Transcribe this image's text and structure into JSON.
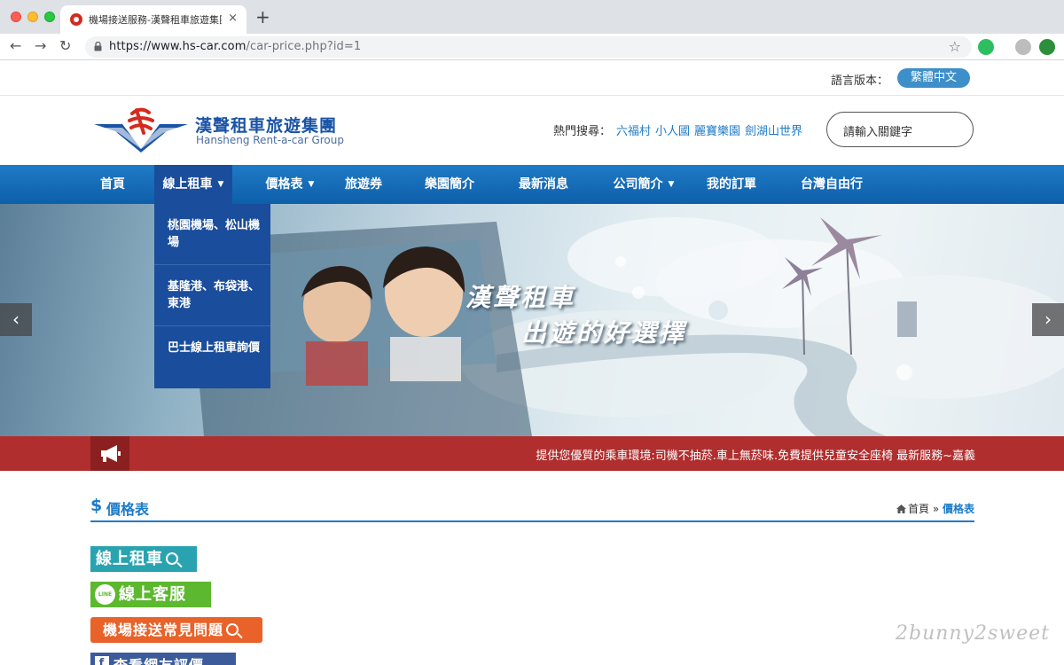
{
  "browser": {
    "tab_title": "機場接送服務-漢聲租車旅遊集團",
    "tab_close": "×",
    "new_tab": "+",
    "url_host": "https://www.hs-car.com",
    "url_path": "/car-price.php?id=1",
    "back": "←",
    "forward": "→",
    "reload": "↻",
    "bookmark": "☆"
  },
  "lang": {
    "label": "語言版本：",
    "current": "繁體中文"
  },
  "brand": {
    "name_zh": "漢聲租車旅遊集團",
    "name_en": "Hansheng Rent-a-car Group"
  },
  "hot_search": {
    "label": "熱門搜尋：",
    "links": [
      "六福村",
      "小人國",
      "麗寶樂園",
      "劍湖山世界"
    ],
    "placeholder": "請輸入關鍵字"
  },
  "nav": {
    "items": [
      {
        "label": "首頁",
        "caret": ""
      },
      {
        "label": "線上租車",
        "caret": "▼"
      },
      {
        "label": "價格表",
        "caret": "▼"
      },
      {
        "label": "旅遊券",
        "caret": ""
      },
      {
        "label": "樂園簡介",
        "caret": ""
      },
      {
        "label": "最新消息",
        "caret": ""
      },
      {
        "label": "公司簡介",
        "caret": "▼"
      },
      {
        "label": "我的訂單",
        "caret": ""
      },
      {
        "label": "台灣自由行",
        "caret": ""
      }
    ],
    "dropdown": [
      "桃園機場、松山機場",
      "基隆港、布袋港、東港",
      "巴士線上租車詢價"
    ]
  },
  "banner": {
    "line1": "漢聲租車",
    "line2": "出遊的好選擇",
    "prev": "‹",
    "next": "›"
  },
  "news": {
    "text": "提供您優質的乘車環境:司機不抽菸.車上無菸味.免費提供兒童安全座椅  最新服務~嘉義"
  },
  "section": {
    "icon": "$",
    "title": "價格表",
    "breadcrumb_home": "首頁",
    "breadcrumb_sep": "»",
    "breadcrumb_current": "價格表"
  },
  "buttons": {
    "rent": "線上租車",
    "line_badge": "LINE",
    "line": "線上客服",
    "faq": "機場接送常見問題",
    "fb_badge": "f",
    "fb": "查看網友評價"
  },
  "watermark": "2bunny2sweet",
  "colors": {
    "nav_blue": "#1f7ac6",
    "nav_active": "#1a4d9c",
    "news_red": "#b02e2e",
    "link_blue": "#1d7bc9",
    "lang_btn": "#3d8fc9"
  }
}
